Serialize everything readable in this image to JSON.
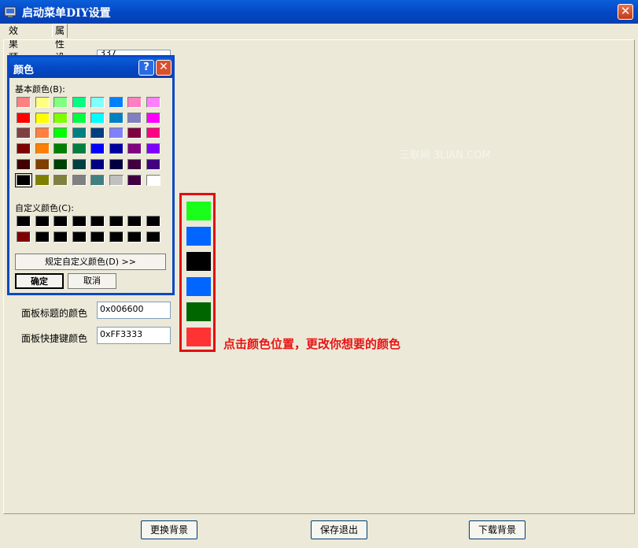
{
  "window": {
    "title": "启动菜单DIY设置",
    "close_label": "✕"
  },
  "tabs": [
    {
      "label": "效果预览"
    },
    {
      "label": "属性设置"
    }
  ],
  "fields": [
    {
      "label": "面板标题的颜色",
      "value": "0x006600"
    },
    {
      "label": "面板快捷键颜色",
      "value": "0xFF3333"
    }
  ],
  "partial_field_value": "337",
  "watermark": "三联网 3LIAN.COM",
  "swatch_colors": [
    "#1aff1a",
    "#0066ff",
    "#000000",
    "#0066ff",
    "#006600",
    "#ff3333"
  ],
  "hint": "点击颜色位置，更改你想要的颜色",
  "buttons": {
    "change_bg": "更换背景",
    "save_exit": "保存退出",
    "download_bg": "下载背景"
  },
  "color_dialog": {
    "title": "颜色",
    "help_label": "?",
    "close_label": "✕",
    "basic_label": "基本颜色(B):",
    "custom_label": "自定义颜色(C):",
    "define_button": "规定自定义颜色(D) >>",
    "ok_button": "确定",
    "cancel_button": "取消",
    "basic_colors": [
      [
        "#ff8080",
        "#ffff80",
        "#80ff80",
        "#00ff80",
        "#80ffff",
        "#0080ff",
        "#ff80c0",
        "#ff80ff"
      ],
      [
        "#ff0000",
        "#ffff00",
        "#80ff00",
        "#00ff40",
        "#00ffff",
        "#0080c0",
        "#8080c0",
        "#ff00ff"
      ],
      [
        "#804040",
        "#ff8040",
        "#00ff00",
        "#008080",
        "#004080",
        "#8080ff",
        "#800040",
        "#ff0080"
      ],
      [
        "#800000",
        "#ff8000",
        "#008000",
        "#008040",
        "#0000ff",
        "#0000a0",
        "#800080",
        "#8000ff"
      ],
      [
        "#400000",
        "#804000",
        "#004000",
        "#004040",
        "#000080",
        "#000040",
        "#400040",
        "#400080"
      ],
      [
        "#000000",
        "#808000",
        "#808040",
        "#808080",
        "#408080",
        "#c0c0c0",
        "#400040",
        "#ffffff"
      ]
    ],
    "selected_basic": [
      5,
      0
    ],
    "custom_colors": [
      [
        "#000000",
        "#000000",
        "#000000",
        "#000000",
        "#000000",
        "#000000",
        "#000000",
        "#000000"
      ],
      [
        "#800000",
        "#000000",
        "#000000",
        "#000000",
        "#000000",
        "#000000",
        "#000000",
        "#000000"
      ]
    ]
  }
}
